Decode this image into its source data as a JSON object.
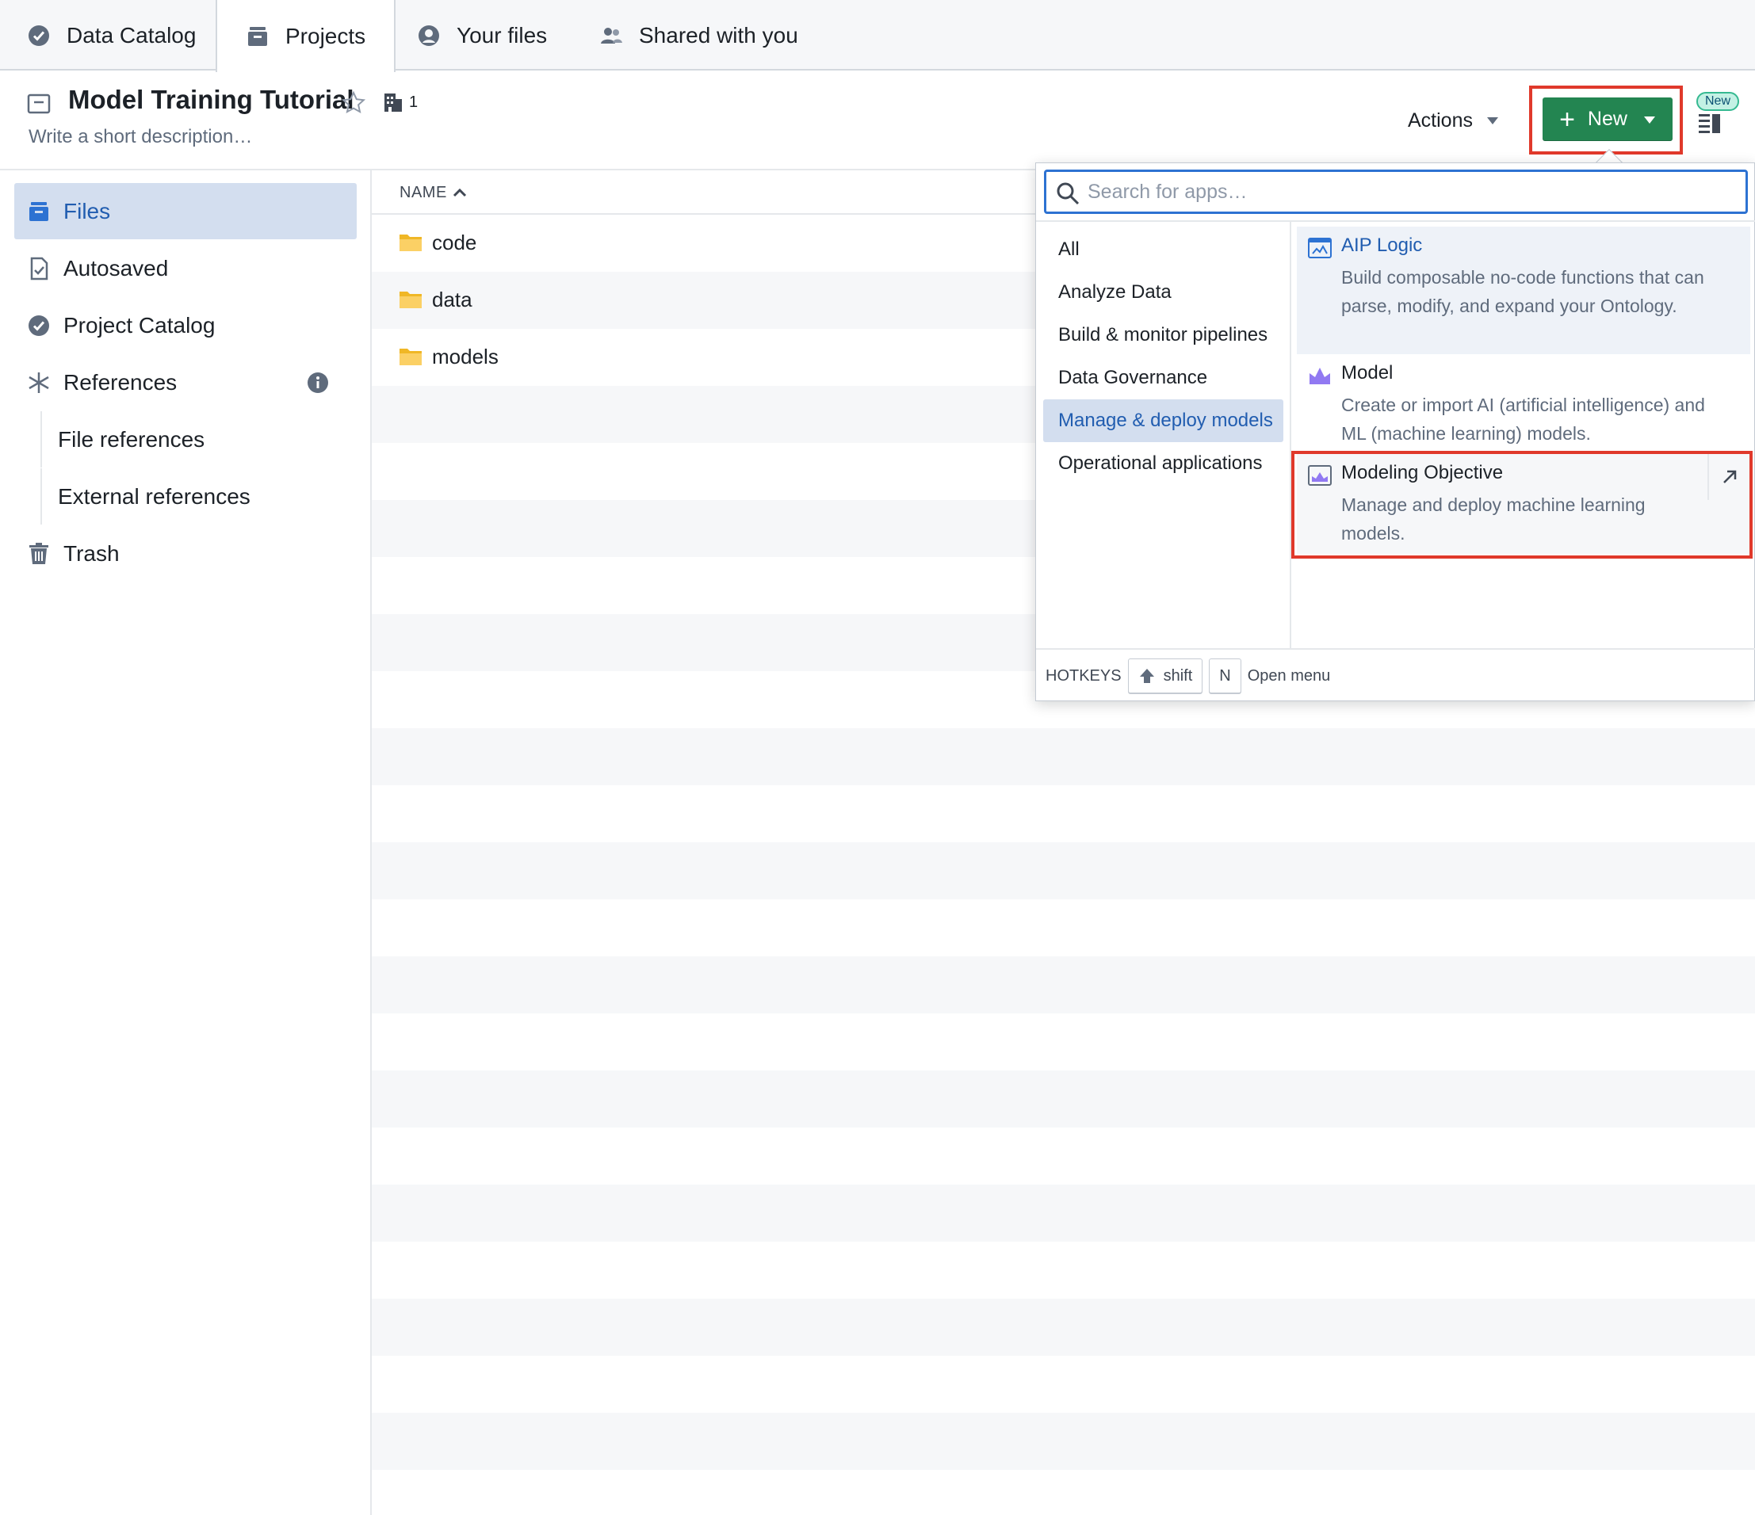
{
  "tabs": [
    {
      "label": "Data Catalog",
      "icon": "verified-badge-icon"
    },
    {
      "label": "Projects",
      "icon": "projects-stack-icon"
    },
    {
      "label": "Your files",
      "icon": "user-circle-icon"
    },
    {
      "label": "Shared with you",
      "icon": "people-icon"
    }
  ],
  "active_tab": "Projects",
  "project": {
    "title": "Model Training Tutorial",
    "description_placeholder": "Write a short description…",
    "org_count": "1"
  },
  "header": {
    "actions_label": "Actions",
    "new_label": "New",
    "new_badge": "New"
  },
  "sidebar": {
    "items": [
      {
        "label": "Files",
        "icon": "files-stack-icon"
      },
      {
        "label": "Autosaved",
        "icon": "autosaved-document-icon"
      },
      {
        "label": "Project Catalog",
        "icon": "verified-badge-icon"
      },
      {
        "label": "References",
        "icon": "asterisk-icon"
      },
      {
        "label": "File references"
      },
      {
        "label": "External references"
      },
      {
        "label": "Trash",
        "icon": "trash-icon"
      }
    ],
    "active": "Files"
  },
  "filelist": {
    "column_name": "NAME",
    "sort": "ascending",
    "rows": [
      {
        "name": "code"
      },
      {
        "name": "data"
      },
      {
        "name": "models"
      }
    ]
  },
  "popover": {
    "search_placeholder": "Search for apps…",
    "categories": [
      "All",
      "Analyze Data",
      "Build & monitor pipelines",
      "Data Governance",
      "Manage & deploy models",
      "Operational applications"
    ],
    "active_category": "Manage & deploy models",
    "apps": [
      {
        "name": "AIP Logic",
        "description": "Build composable no-code functions that can parse, modify, and expand your Ontology.",
        "icon": "aip-logic-icon"
      },
      {
        "name": "Model",
        "description": "Create or import AI (artificial intelligence) and ML (machine learning) models.",
        "icon": "model-icon"
      },
      {
        "name": "Modeling Objective",
        "description": "Manage and deploy machine learning models.",
        "icon": "modeling-objective-icon"
      }
    ],
    "footer": {
      "hotkeys_label": "HOTKEYS",
      "key_shift": "shift",
      "key_n": "N",
      "action_label": "Open menu"
    }
  },
  "colors": {
    "accent_blue": "#215db0",
    "new_button_green": "#238551",
    "highlight_red": "#e0392b",
    "active_bg": "#d3deef"
  }
}
